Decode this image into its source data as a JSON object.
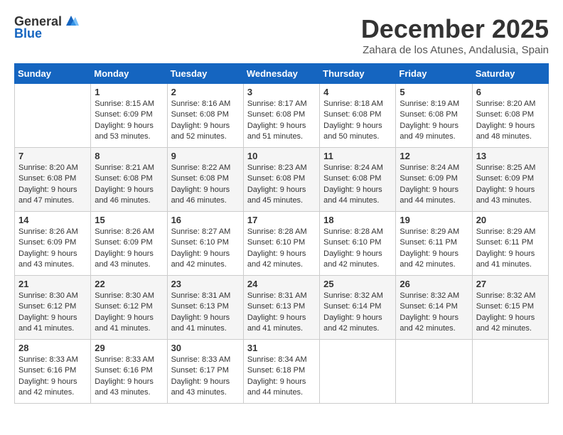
{
  "header": {
    "logo_general": "General",
    "logo_blue": "Blue",
    "month": "December 2025",
    "location": "Zahara de los Atunes, Andalusia, Spain"
  },
  "days_of_week": [
    "Sunday",
    "Monday",
    "Tuesday",
    "Wednesday",
    "Thursday",
    "Friday",
    "Saturday"
  ],
  "weeks": [
    [
      {
        "day": "",
        "info": ""
      },
      {
        "day": "1",
        "info": "Sunrise: 8:15 AM\nSunset: 6:09 PM\nDaylight: 9 hours\nand 53 minutes."
      },
      {
        "day": "2",
        "info": "Sunrise: 8:16 AM\nSunset: 6:08 PM\nDaylight: 9 hours\nand 52 minutes."
      },
      {
        "day": "3",
        "info": "Sunrise: 8:17 AM\nSunset: 6:08 PM\nDaylight: 9 hours\nand 51 minutes."
      },
      {
        "day": "4",
        "info": "Sunrise: 8:18 AM\nSunset: 6:08 PM\nDaylight: 9 hours\nand 50 minutes."
      },
      {
        "day": "5",
        "info": "Sunrise: 8:19 AM\nSunset: 6:08 PM\nDaylight: 9 hours\nand 49 minutes."
      },
      {
        "day": "6",
        "info": "Sunrise: 8:20 AM\nSunset: 6:08 PM\nDaylight: 9 hours\nand 48 minutes."
      }
    ],
    [
      {
        "day": "7",
        "info": ""
      },
      {
        "day": "8",
        "info": "Sunrise: 8:21 AM\nSunset: 6:08 PM\nDaylight: 9 hours\nand 46 minutes."
      },
      {
        "day": "9",
        "info": "Sunrise: 8:22 AM\nSunset: 6:08 PM\nDaylight: 9 hours\nand 46 minutes."
      },
      {
        "day": "10",
        "info": "Sunrise: 8:23 AM\nSunset: 6:08 PM\nDaylight: 9 hours\nand 45 minutes."
      },
      {
        "day": "11",
        "info": "Sunrise: 8:24 AM\nSunset: 6:08 PM\nDaylight: 9 hours\nand 44 minutes."
      },
      {
        "day": "12",
        "info": "Sunrise: 8:24 AM\nSunset: 6:09 PM\nDaylight: 9 hours\nand 44 minutes."
      },
      {
        "day": "13",
        "info": "Sunrise: 8:25 AM\nSunset: 6:09 PM\nDaylight: 9 hours\nand 43 minutes."
      }
    ],
    [
      {
        "day": "14",
        "info": "Sunrise: 8:26 AM\nSunset: 6:09 PM\nDaylight: 9 hours\nand 43 minutes."
      },
      {
        "day": "15",
        "info": "Sunrise: 8:26 AM\nSunset: 6:09 PM\nDaylight: 9 hours\nand 43 minutes."
      },
      {
        "day": "16",
        "info": "Sunrise: 8:27 AM\nSunset: 6:10 PM\nDaylight: 9 hours\nand 42 minutes."
      },
      {
        "day": "17",
        "info": "Sunrise: 8:28 AM\nSunset: 6:10 PM\nDaylight: 9 hours\nand 42 minutes."
      },
      {
        "day": "18",
        "info": "Sunrise: 8:28 AM\nSunset: 6:10 PM\nDaylight: 9 hours\nand 42 minutes."
      },
      {
        "day": "19",
        "info": "Sunrise: 8:29 AM\nSunset: 6:11 PM\nDaylight: 9 hours\nand 42 minutes."
      },
      {
        "day": "20",
        "info": "Sunrise: 8:29 AM\nSunset: 6:11 PM\nDaylight: 9 hours\nand 41 minutes."
      }
    ],
    [
      {
        "day": "21",
        "info": "Sunrise: 8:30 AM\nSunset: 6:12 PM\nDaylight: 9 hours\nand 41 minutes."
      },
      {
        "day": "22",
        "info": "Sunrise: 8:30 AM\nSunset: 6:12 PM\nDaylight: 9 hours\nand 41 minutes."
      },
      {
        "day": "23",
        "info": "Sunrise: 8:31 AM\nSunset: 6:13 PM\nDaylight: 9 hours\nand 41 minutes."
      },
      {
        "day": "24",
        "info": "Sunrise: 8:31 AM\nSunset: 6:13 PM\nDaylight: 9 hours\nand 41 minutes."
      },
      {
        "day": "25",
        "info": "Sunrise: 8:32 AM\nSunset: 6:14 PM\nDaylight: 9 hours\nand 42 minutes."
      },
      {
        "day": "26",
        "info": "Sunrise: 8:32 AM\nSunset: 6:14 PM\nDaylight: 9 hours\nand 42 minutes."
      },
      {
        "day": "27",
        "info": "Sunrise: 8:32 AM\nSunset: 6:15 PM\nDaylight: 9 hours\nand 42 minutes."
      }
    ],
    [
      {
        "day": "28",
        "info": "Sunrise: 8:33 AM\nSunset: 6:16 PM\nDaylight: 9 hours\nand 42 minutes."
      },
      {
        "day": "29",
        "info": "Sunrise: 8:33 AM\nSunset: 6:16 PM\nDaylight: 9 hours\nand 43 minutes."
      },
      {
        "day": "30",
        "info": "Sunrise: 8:33 AM\nSunset: 6:17 PM\nDaylight: 9 hours\nand 43 minutes."
      },
      {
        "day": "31",
        "info": "Sunrise: 8:34 AM\nSunset: 6:18 PM\nDaylight: 9 hours\nand 44 minutes."
      },
      {
        "day": "",
        "info": ""
      },
      {
        "day": "",
        "info": ""
      },
      {
        "day": "",
        "info": ""
      }
    ]
  ],
  "week1_sunday_info": "Sunrise: 8:20 AM\nSunset: 6:08 PM\nDaylight: 9 hours\nand 47 minutes.",
  "week2_sunday_info": "Sunrise: 8:20 AM\nSunset: 6:08 PM\nDaylight: 9 hours\nand 47 minutes."
}
